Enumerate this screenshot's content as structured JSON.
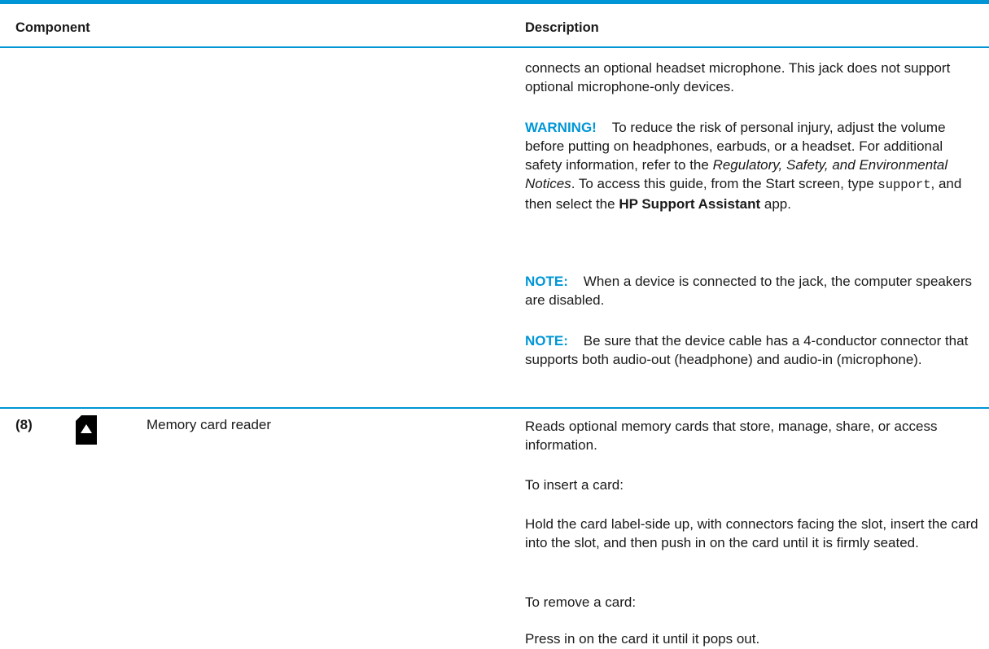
{
  "table": {
    "headers": {
      "component": "Component",
      "description": "Description"
    },
    "row_prev": {
      "p1": "connects an optional headset microphone. This jack does not support optional microphone-only devices.",
      "warning": {
        "label": "WARNING!",
        "text_a": "To reduce the risk of personal injury, adjust the volume before putting on headphones, earbuds, or a headset. For additional safety information, refer to the",
        "italic": "Regulatory, Safety, and Environmental Notices",
        "text_b": ". To access this guide, from the Start screen, type",
        "code": "support",
        "text_c": ", and then select the",
        "bold": "HP Support Assistant",
        "text_d": "app."
      },
      "note1": {
        "label": "NOTE:",
        "text": "When a device is connected to the jack, the computer speakers are disabled."
      },
      "note2": {
        "label": "NOTE:",
        "text": "Be sure that the device cable has a 4-conductor connector that supports both audio-out (headphone) and audio-in (microphone)."
      }
    },
    "row8": {
      "number": "(8)",
      "icon": "memory-card-icon",
      "name": "Memory card reader",
      "desc": [
        "Reads optional memory cards that store, manage, share, or access information.",
        "To insert a card:",
        "Hold the card label-side up, with connectors facing the slot, insert the card into the slot, and then push in on the card until it is firmly seated.",
        "To remove a card:",
        "Press in on the card it until it pops out."
      ]
    }
  },
  "colors": {
    "accent": "#0096d6",
    "text": "#1a1a1a"
  }
}
